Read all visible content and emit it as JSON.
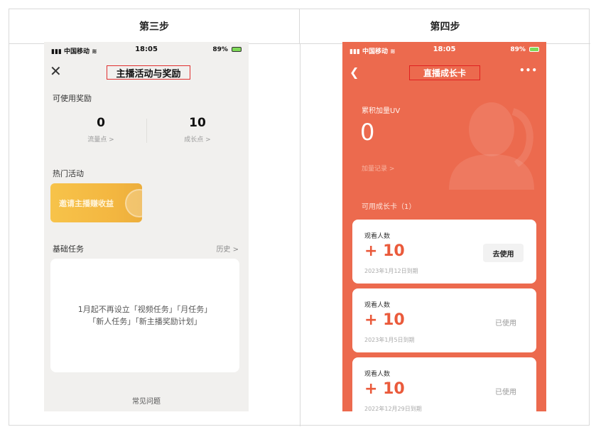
{
  "headers": {
    "left": "第三步",
    "right": "第四步"
  },
  "phone1": {
    "status": {
      "carrier": "中国移动",
      "time": "18:05",
      "battery": "89%"
    },
    "title": "主播活动与奖励",
    "rewards_label": "可使用奖励",
    "rewards": [
      {
        "value": "0",
        "label": "流量点 >"
      },
      {
        "value": "10",
        "label": "成长点 >"
      }
    ],
    "hot_label": "热门活动",
    "invite_text": "邀请主播赚收益",
    "tasks_label": "基础任务",
    "history": "历史 >",
    "notice_line1": "1月起不再设立「视频任务」「月任务」",
    "notice_line2": "「新人任务」「新主播奖励计划」",
    "faq": "常见问题"
  },
  "phone2": {
    "status": {
      "carrier": "中国移动",
      "time": "18:05",
      "battery": "89%"
    },
    "title": "直播成长卡",
    "uv_label": "累积加量UV",
    "uv_value": "0",
    "add_record": "加量记录 >",
    "available": "可用成长卡（1）",
    "cards": [
      {
        "label": "观看人数",
        "value": "+ 10",
        "expiry": "2023年1月12日到期",
        "action": "去使用"
      },
      {
        "label": "观看人数",
        "value": "+ 10",
        "expiry": "2023年1月5日到期",
        "action": "已使用"
      },
      {
        "label": "观看人数",
        "value": "+ 10",
        "expiry": "2022年12月29日到期",
        "action": "已使用"
      }
    ]
  },
  "colors": {
    "orange_bg": "#ec6a4e",
    "accent": "#ea5a3b",
    "highlight_border": "#e03030",
    "gold": "#f3b640"
  },
  "icons": [
    "signal-icon",
    "wifi-icon",
    "battery-icon",
    "close-icon",
    "back-icon",
    "more-icon"
  ]
}
